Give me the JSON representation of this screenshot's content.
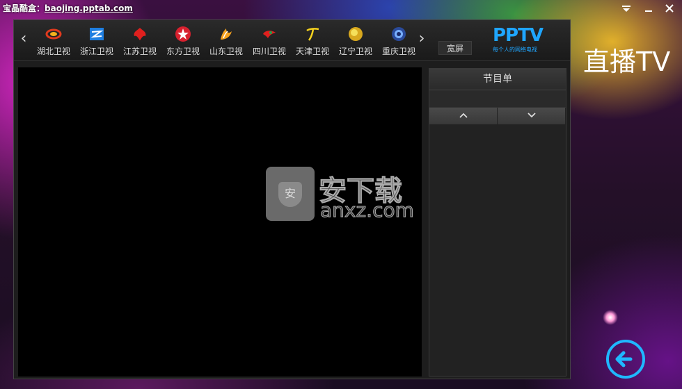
{
  "window": {
    "title_prefix": "宝晶酷盒：",
    "title_url": "baojing.pptab.com",
    "controls": [
      "menu",
      "minimize",
      "close"
    ]
  },
  "channels": {
    "items": [
      {
        "name": "湖北卫视",
        "icon": "hubei-logo-icon"
      },
      {
        "name": "浙江卫视",
        "icon": "zhejiang-logo-icon"
      },
      {
        "name": "江苏卫视",
        "icon": "jiangsu-logo-icon"
      },
      {
        "name": "东方卫视",
        "icon": "dongfang-logo-icon"
      },
      {
        "name": "山东卫视",
        "icon": "shandong-logo-icon"
      },
      {
        "name": "四川卫视",
        "icon": "sichuan-logo-icon"
      },
      {
        "name": "天津卫视",
        "icon": "tianjin-logo-icon"
      },
      {
        "name": "辽宁卫视",
        "icon": "liaoning-logo-icon"
      },
      {
        "name": "重庆卫视",
        "icon": "chongqing-logo-icon"
      }
    ],
    "widescreen_label": "宽屏"
  },
  "brand": {
    "logo_text": "PPTV",
    "slogan": "每个人的网络电视",
    "color": "#1fa6ff"
  },
  "program_guide": {
    "title": "节目单",
    "up_icon": "chevron-up-icon",
    "down_icon": "chevron-down-icon"
  },
  "watermark": {
    "chinese": "安下载",
    "english": "anxz.com",
    "badge_char": "安"
  },
  "side": {
    "title": "直播TV"
  }
}
